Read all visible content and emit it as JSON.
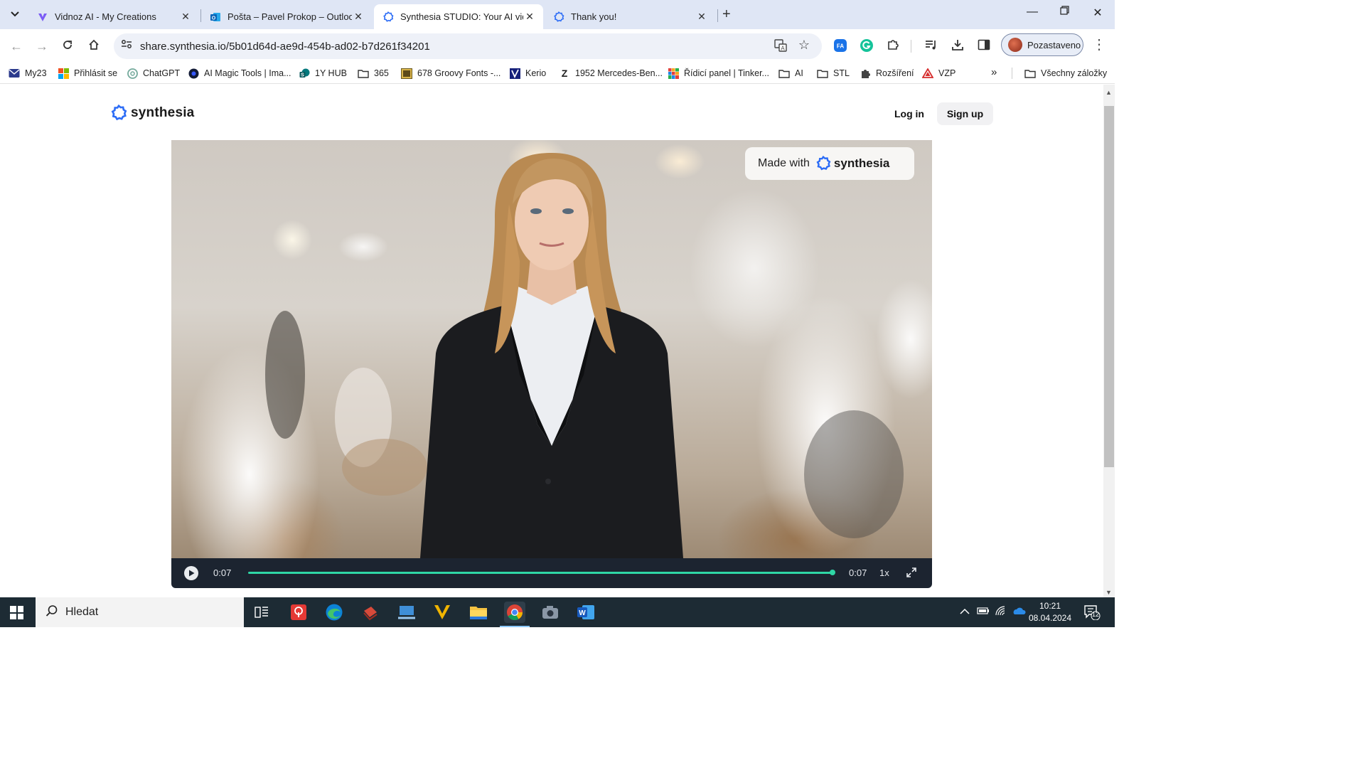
{
  "browser": {
    "tabs": [
      {
        "title": "Vidnoz AI - My Creations",
        "active": false
      },
      {
        "title": "Pošta – Pavel Prokop – Outlook",
        "active": false
      },
      {
        "title": "Synthesia STUDIO: Your AI video",
        "active": true
      },
      {
        "title": "Thank you!",
        "active": false
      }
    ],
    "url": "share.synthesia.io/5b01d64d-ae9d-454b-ad02-b7d261f34201",
    "profile_label": "Pozastaveno",
    "bookmarks": [
      {
        "label": "My23",
        "icon": "envelope-icon"
      },
      {
        "label": "Přihlásit se",
        "icon": "microsoft-icon"
      },
      {
        "label": "ChatGPT",
        "icon": "openai-icon"
      },
      {
        "label": "AI Magic Tools | Ima...",
        "icon": "circle-logo-icon"
      },
      {
        "label": "1Y HUB",
        "icon": "sharepoint-icon"
      },
      {
        "label": "365",
        "icon": "folder-icon"
      },
      {
        "label": "678 Groovy Fonts -...",
        "icon": "fonts-icon"
      },
      {
        "label": "Kerio",
        "icon": "kerio-icon"
      },
      {
        "label": "1952 Mercedes-Ben...",
        "icon": "z-icon"
      },
      {
        "label": "Řídicí panel | Tinker...",
        "icon": "tinkercad-icon"
      },
      {
        "label": "AI",
        "icon": "folder-icon"
      },
      {
        "label": "STL",
        "icon": "folder-icon"
      },
      {
        "label": "Rozšíření",
        "icon": "puzzle-icon"
      },
      {
        "label": "VZP",
        "icon": "vzp-icon"
      }
    ],
    "all_bookmarks_label": "Všechny záložky"
  },
  "page": {
    "brand": "synthesia",
    "login_label": "Log in",
    "signup_label": "Sign up",
    "watermark_prefix": "Made with",
    "watermark_brand": "synthesia",
    "player": {
      "current_time": "0:07",
      "duration": "0:07",
      "speed": "1x",
      "progress": 1.0,
      "accent": "#2fd6a6"
    }
  },
  "taskbar": {
    "search_placeholder": "Hledat",
    "time": "10:21",
    "date": "08.04.2024",
    "notifications": "12"
  }
}
